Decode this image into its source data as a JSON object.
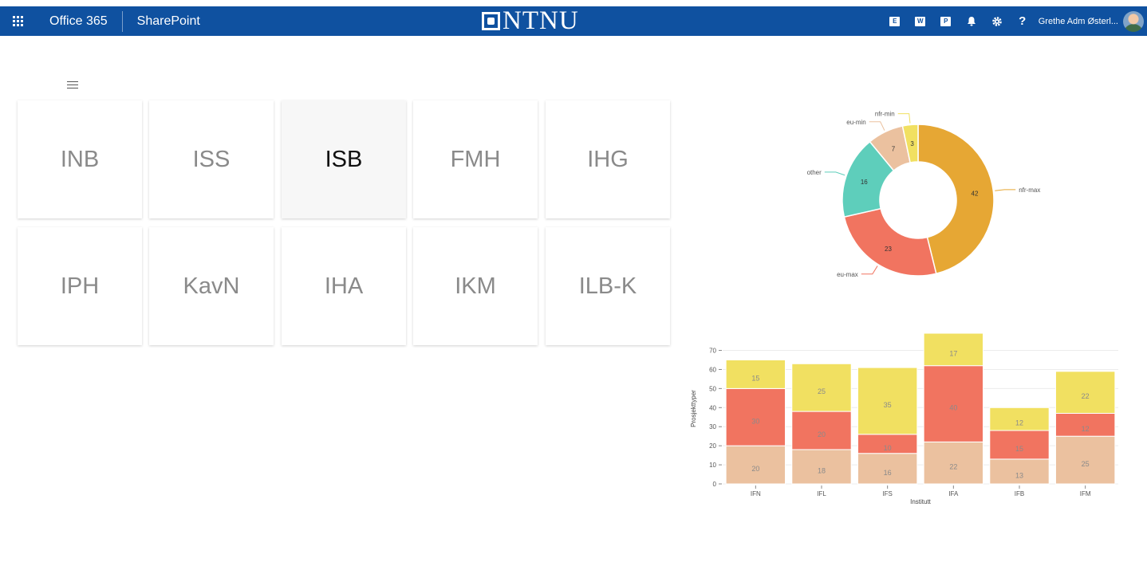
{
  "header": {
    "app_name": "Office 365",
    "site_name": "SharePoint",
    "brand_text": "NTNU",
    "user_name": "Grethe Adm Østerl...",
    "icons": [
      "waffle-icon",
      "exchange-icon",
      "word-icon",
      "powerpoint-icon",
      "bell-icon",
      "gear-icon",
      "help-icon"
    ],
    "accent": "#0f51a0"
  },
  "tiles": [
    {
      "label": "INB",
      "active": false
    },
    {
      "label": "ISS",
      "active": false
    },
    {
      "label": "ISB",
      "active": true
    },
    {
      "label": "FMH",
      "active": false
    },
    {
      "label": "IHG",
      "active": false
    },
    {
      "label": "IPH",
      "active": false
    },
    {
      "label": "KavN",
      "active": false
    },
    {
      "label": "IHA",
      "active": false
    },
    {
      "label": "IKM",
      "active": false
    },
    {
      "label": "ILB-K",
      "active": false
    }
  ],
  "chart_data": [
    {
      "type": "pie",
      "donut": true,
      "slices": [
        {
          "label": "nfr-max",
          "value": 42,
          "color": "#e6a734"
        },
        {
          "label": "eu-max",
          "value": 23,
          "color": "#f17460"
        },
        {
          "label": "other",
          "value": 16,
          "color": "#5ecebb"
        },
        {
          "label": "eu-min",
          "value": 7,
          "color": "#ebc19f"
        },
        {
          "label": "nfr-min",
          "value": 3,
          "color": "#f1e061"
        }
      ]
    },
    {
      "type": "bar",
      "stacked": true,
      "categories": [
        "IFN",
        "IFL",
        "IFS",
        "IFA",
        "IFB",
        "IFM"
      ],
      "series": [
        {
          "values": [
            20,
            18,
            16,
            22,
            13,
            25
          ],
          "color": "#ebc19f"
        },
        {
          "values": [
            30,
            20,
            10,
            40,
            15,
            12
          ],
          "color": "#f17460"
        },
        {
          "values": [
            15,
            25,
            35,
            17,
            12,
            22
          ],
          "color": "#f1e061"
        }
      ],
      "xlabel": "Institutt",
      "ylabel": "Prosjekttyper",
      "yticks": [
        0,
        10,
        20,
        30,
        40,
        50,
        60,
        70
      ],
      "ylim": [
        0,
        79
      ],
      "grid": true
    }
  ]
}
